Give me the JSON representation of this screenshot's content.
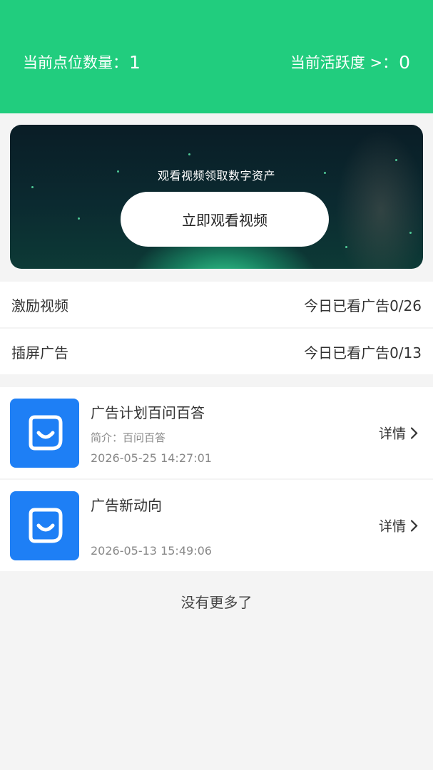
{
  "header": {
    "points_label": "当前点位数量：",
    "points_value": "1",
    "activity_label": "当前活跃度 >：",
    "activity_value": "0",
    "bg_color": "#21cd7e"
  },
  "banner": {
    "caption": "观看视频领取数字资产",
    "button_label": "立即观看视频"
  },
  "ad_stats": [
    {
      "label": "激励视频",
      "value": "今日已看广告0/26"
    },
    {
      "label": "插屏广告",
      "value": "今日已看广告0/13"
    }
  ],
  "news": [
    {
      "title": "广告计划百问百答",
      "desc": "简介：百问百答",
      "date": "2026-05-25 14:27:01",
      "detail_label": "详情",
      "icon": "smiley-face-icon"
    },
    {
      "title": "广告新动向",
      "desc": "",
      "date": "2026-05-13 15:49:06",
      "detail_label": "详情",
      "icon": "smiley-face-icon"
    }
  ],
  "footer": {
    "no_more_text": "没有更多了"
  }
}
